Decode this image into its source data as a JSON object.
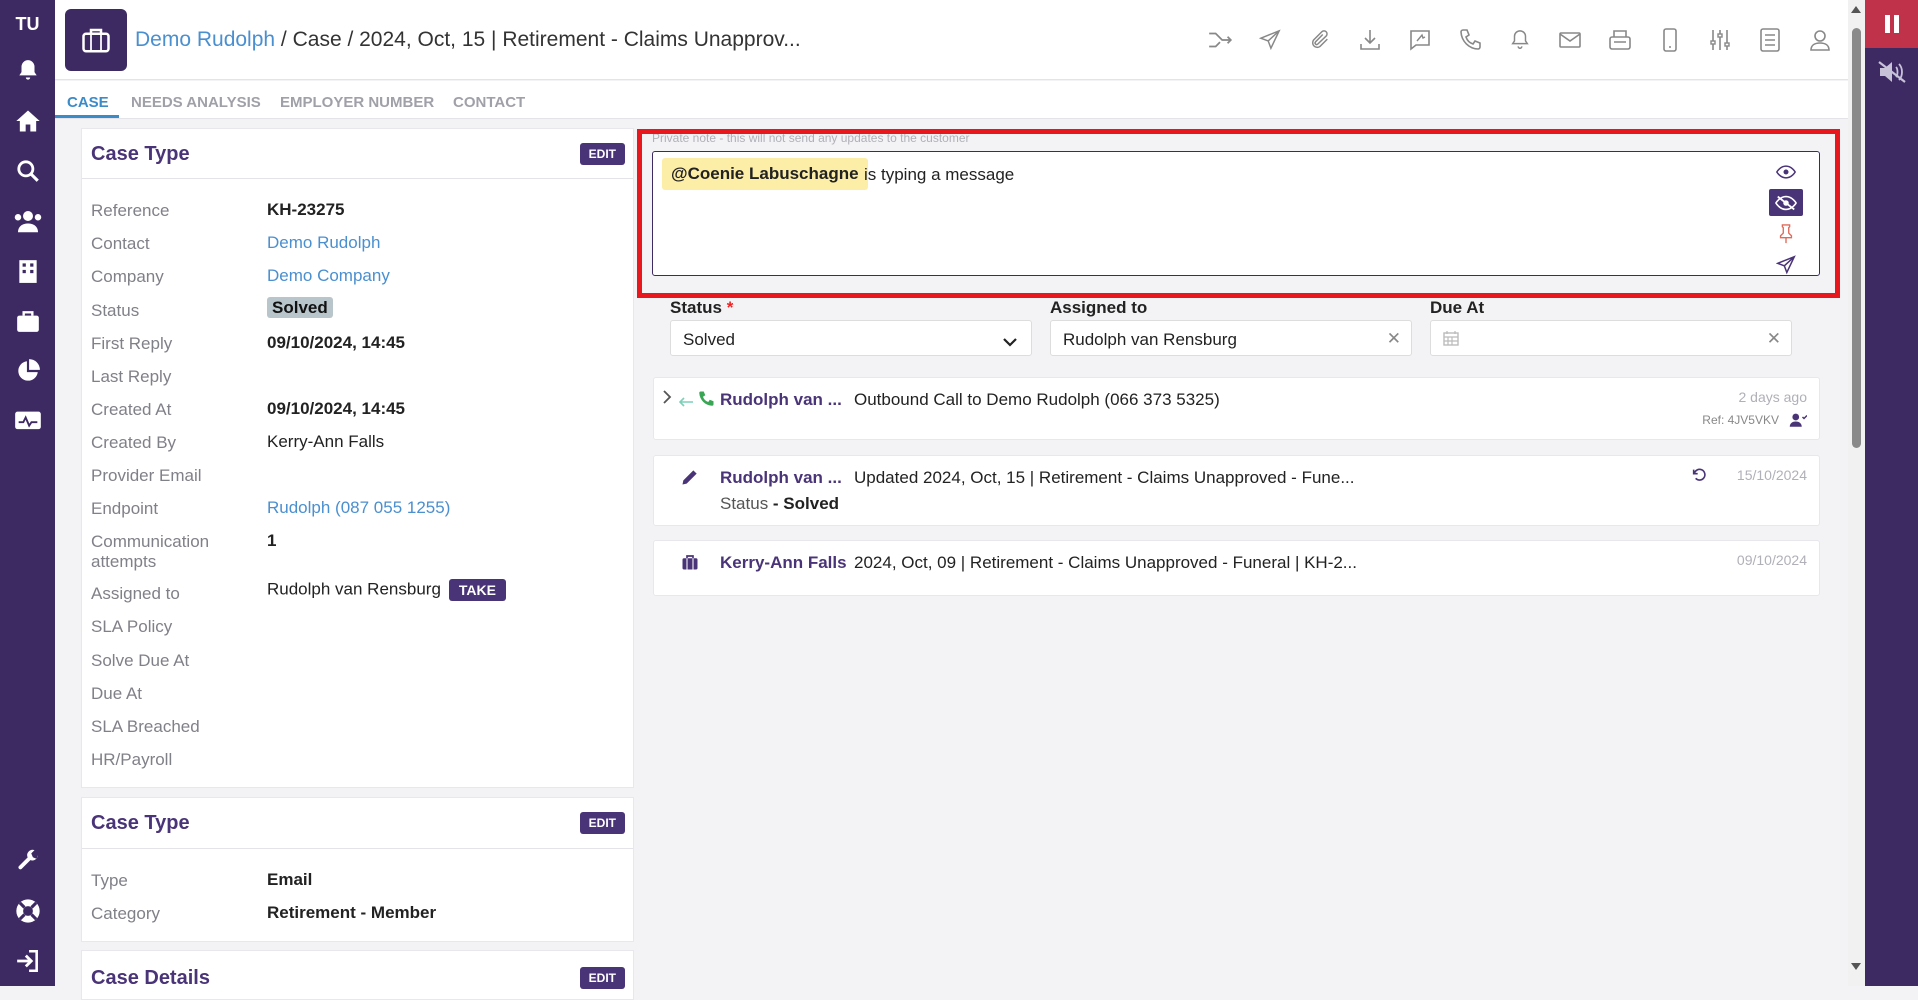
{
  "nav": {
    "initials": "TU"
  },
  "header": {
    "crumb_contact": "Demo Rudolph",
    "crumb_rest": " / Case / 2024, Oct, 15 | Retirement - Claims Unapprov..."
  },
  "tabs": [
    "CASE",
    "NEEDS ANALYSIS",
    "EMPLOYER NUMBER",
    "CONTACT"
  ],
  "case_panel": {
    "title": "Case Type",
    "edit_label": "EDIT",
    "fields": {
      "reference_label": "Reference",
      "reference": "KH-23275",
      "contact_label": "Contact",
      "contact": "Demo Rudolph",
      "company_label": "Company",
      "company": "Demo Company",
      "status_label": "Status",
      "status": "Solved",
      "first_reply_label": "First Reply",
      "first_reply": "09/10/2024, 14:45",
      "last_reply_label": "Last Reply",
      "created_at_label": "Created At",
      "created_at": "09/10/2024, 14:45",
      "created_by_label": "Created By",
      "created_by": "Kerry-Ann Falls",
      "provider_email_label": "Provider Email",
      "endpoint_label": "Endpoint",
      "endpoint": "Rudolph (087 055 1255)",
      "comm_label_1": "Communication",
      "comm_label_2": "attempts",
      "comm": "1",
      "assigned_label": "Assigned to",
      "assigned": "Rudolph van Rensburg",
      "take_label": "TAKE",
      "sla_policy_label": "SLA Policy",
      "solve_due_label": "Solve Due At",
      "due_at_label": "Due At",
      "sla_breached_label": "SLA Breached",
      "hr_label": "HR/Payroll"
    }
  },
  "type_panel": {
    "title": "Case Type",
    "edit_label": "EDIT",
    "type_label": "Type",
    "type": "Email",
    "category_label": "Category",
    "category": "Retirement - Member"
  },
  "details_panel": {
    "title": "Case Details",
    "edit_label": "EDIT"
  },
  "note": {
    "hint": "Private note - this will not send any updates to the customer",
    "mention": "@Coenie Labuschagne",
    "typing": "is typing a message"
  },
  "fields": {
    "status_label": "Status",
    "status_required": "*",
    "status_value": "Solved",
    "assigned_label": "Assigned to",
    "assigned_value": "Rudolph van Rensburg",
    "due_label": "Due At",
    "clear_glyph": "✕"
  },
  "timeline": [
    {
      "name": "Rudolph van ...",
      "text": "Outbound Call to Demo Rudolph (066 373 5325)",
      "date": "2 days ago",
      "ref": "Ref: 4JV5VKV"
    },
    {
      "name": "Rudolph van ...",
      "text": "Updated 2024, Oct, 15 | Retirement - Claims Unapproved - Fune...",
      "sub_label": "Status",
      "sub_value": " - Solved",
      "date": "15/10/2024"
    },
    {
      "name": "Kerry-Ann Falls",
      "text": "2024, Oct, 09 | Retirement - Claims Unapproved - Funeral | KH-2...",
      "date": "09/10/2024"
    }
  ],
  "colors": {
    "brand": "#3d2a63",
    "accent": "#4a3478",
    "link": "#4a8fcf",
    "highlight": "#e8161d",
    "mention_bg": "#fdeea7"
  }
}
